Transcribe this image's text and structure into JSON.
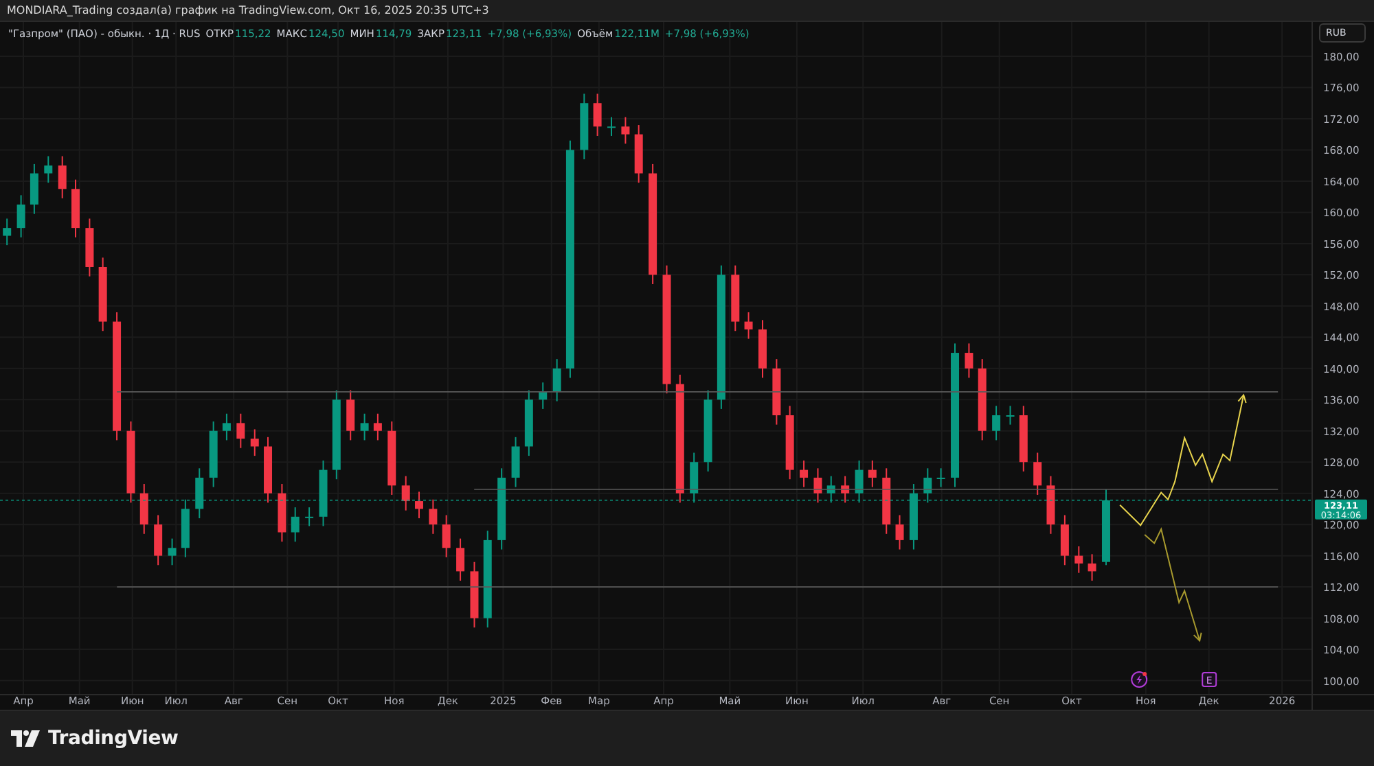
{
  "header": {
    "title": "MONDIARA_Trading создал(а) график на TradingView.com, Окт 16, 2025 20:35 UTC+3"
  },
  "legend": {
    "symbol": "\"Газпром\" (ПАО) - обыкн. · 1Д · RUS",
    "fields": [
      {
        "label": "ОТКР",
        "value": "115,22"
      },
      {
        "label": "МАКС",
        "value": "124,50"
      },
      {
        "label": "МИН",
        "value": "114,79"
      },
      {
        "label": "ЗАКР",
        "value": "123,11"
      },
      {
        "value": "+7,98 (+6,93%)"
      },
      {
        "label": "Объём",
        "value": "122,11M"
      },
      {
        "value": "+7,98 (+6,93%)"
      }
    ]
  },
  "currency_button": "RUB",
  "price_tag": {
    "countdown": "03:14:06"
  },
  "events": [
    {
      "kind": "dividend"
    },
    {
      "kind": "earnings",
      "label": "E"
    }
  ],
  "chart_data": {
    "type": "candlestick",
    "grid": true,
    "xlim": [
      2024.354,
      2026.118
    ],
    "ylim": [
      98.2,
      184.4
    ],
    "x": [
      2024.363,
      2024.381,
      2024.398,
      2024.416,
      2024.434,
      2024.451,
      2024.469,
      2024.486,
      2024.504,
      2024.522,
      2024.539,
      2024.557,
      2024.575,
      2024.592,
      2024.61,
      2024.628,
      2024.645,
      2024.663,
      2024.681,
      2024.698,
      2024.716,
      2024.733,
      2024.751,
      2024.769,
      2024.786,
      2024.804,
      2024.822,
      2024.839,
      2024.857,
      2024.875,
      2024.892,
      2024.91,
      2024.927,
      2024.945,
      2024.963,
      2024.98,
      2024.998,
      2025.016,
      2025.033,
      2025.051,
      2025.069,
      2025.086,
      2025.104,
      2025.121,
      2025.139,
      2025.157,
      2025.174,
      2025.192,
      2025.21,
      2025.227,
      2025.245,
      2025.263,
      2025.28,
      2025.298,
      2025.315,
      2025.333,
      2025.351,
      2025.368,
      2025.386,
      2025.404,
      2025.421,
      2025.439,
      2025.457,
      2025.474,
      2025.492,
      2025.509,
      2025.527,
      2025.545,
      2025.562,
      2025.58,
      2025.598,
      2025.615,
      2025.633,
      2025.651,
      2025.668,
      2025.686,
      2025.703,
      2025.721,
      2025.739,
      2025.756,
      2025.774
    ],
    "ohlc": [
      [
        157,
        159.2,
        155.8,
        158
      ],
      [
        158,
        162.2,
        156.8,
        161
      ],
      [
        161,
        166.2,
        159.8,
        165
      ],
      [
        165,
        167.2,
        163.8,
        166
      ],
      [
        166,
        167.2,
        161.8,
        163
      ],
      [
        163,
        164.2,
        156.8,
        158
      ],
      [
        158,
        159.2,
        151.8,
        153
      ],
      [
        153,
        154.2,
        144.8,
        146
      ],
      [
        146,
        147.2,
        130.8,
        132
      ],
      [
        132,
        133.2,
        122.8,
        124
      ],
      [
        124,
        125.2,
        118.8,
        120
      ],
      [
        120,
        121.2,
        114.8,
        116
      ],
      [
        116,
        118.2,
        114.8,
        117
      ],
      [
        117,
        123.2,
        115.8,
        122
      ],
      [
        122,
        127.2,
        120.8,
        126
      ],
      [
        126,
        133.2,
        124.8,
        132
      ],
      [
        132,
        134.2,
        130.8,
        133
      ],
      [
        133,
        134.2,
        129.8,
        131
      ],
      [
        131,
        132.2,
        128.8,
        130
      ],
      [
        130,
        131.2,
        122.8,
        124
      ],
      [
        124,
        125.2,
        117.8,
        119
      ],
      [
        119,
        122.2,
        117.8,
        121
      ],
      [
        121,
        122.2,
        119.8,
        121
      ],
      [
        121,
        128.2,
        119.8,
        127
      ],
      [
        127,
        137.2,
        125.8,
        136
      ],
      [
        136,
        137.2,
        130.8,
        132
      ],
      [
        132,
        134.2,
        130.8,
        133
      ],
      [
        133,
        134.2,
        130.8,
        132
      ],
      [
        132,
        133.2,
        123.8,
        125
      ],
      [
        125,
        126.2,
        121.8,
        123
      ],
      [
        123,
        124.2,
        120.8,
        122
      ],
      [
        122,
        123.2,
        118.8,
        120
      ],
      [
        120,
        121.2,
        115.8,
        117
      ],
      [
        117,
        118.2,
        112.8,
        114
      ],
      [
        114,
        115.2,
        106.8,
        108
      ],
      [
        108,
        119.2,
        106.8,
        118
      ],
      [
        118,
        127.2,
        116.8,
        126
      ],
      [
        126,
        131.2,
        124.8,
        130
      ],
      [
        130,
        137.2,
        128.8,
        136
      ],
      [
        136,
        138.2,
        134.8,
        137
      ],
      [
        137,
        141.2,
        135.8,
        140
      ],
      [
        140,
        169.2,
        138.8,
        168
      ],
      [
        168,
        175.2,
        166.8,
        174
      ],
      [
        174,
        175.2,
        169.8,
        171
      ],
      [
        171,
        172.2,
        169.8,
        171
      ],
      [
        171,
        172.2,
        168.8,
        170
      ],
      [
        170,
        171.2,
        163.8,
        165
      ],
      [
        165,
        166.2,
        150.8,
        152
      ],
      [
        152,
        153.2,
        136.8,
        138
      ],
      [
        138,
        139.2,
        122.8,
        124
      ],
      [
        124,
        129.2,
        122.8,
        128
      ],
      [
        128,
        137.2,
        126.8,
        136
      ],
      [
        136,
        153.2,
        134.8,
        152
      ],
      [
        152,
        153.2,
        144.8,
        146
      ],
      [
        146,
        147.2,
        143.8,
        145
      ],
      [
        145,
        146.2,
        138.8,
        140
      ],
      [
        140,
        141.2,
        132.8,
        134
      ],
      [
        134,
        135.2,
        125.8,
        127
      ],
      [
        127,
        128.2,
        124.8,
        126
      ],
      [
        126,
        127.2,
        122.8,
        124
      ],
      [
        124,
        126.2,
        122.8,
        125
      ],
      [
        125,
        126.2,
        122.8,
        124
      ],
      [
        124,
        128.2,
        122.8,
        127
      ],
      [
        127,
        128.2,
        124.8,
        126
      ],
      [
        126,
        127.2,
        118.8,
        120
      ],
      [
        120,
        121.2,
        116.8,
        118
      ],
      [
        118,
        125.2,
        116.8,
        124
      ],
      [
        124,
        127.2,
        122.8,
        126
      ],
      [
        126,
        127.2,
        124.8,
        126
      ],
      [
        126,
        143.2,
        124.8,
        142
      ],
      [
        142,
        143.2,
        138.8,
        140
      ],
      [
        140,
        141.2,
        130.8,
        132
      ],
      [
        132,
        135.2,
        130.8,
        134
      ],
      [
        134,
        135.2,
        132.8,
        134
      ],
      [
        134,
        135.2,
        126.8,
        128
      ],
      [
        128,
        129.2,
        123.8,
        125
      ],
      [
        125,
        126.2,
        118.8,
        120
      ],
      [
        120,
        121.2,
        114.8,
        116
      ],
      [
        116,
        117.2,
        113.8,
        115
      ],
      [
        115,
        116.2,
        112.8,
        114
      ],
      [
        115.2,
        124.5,
        114.8,
        123.1
      ]
    ],
    "xticks": [
      {
        "value": 2024.384,
        "label": "Апр"
      },
      {
        "value": 2024.456,
        "label": "Май"
      },
      {
        "value": 2024.524,
        "label": "Июн"
      },
      {
        "value": 2024.58,
        "label": "Июл"
      },
      {
        "value": 2024.654,
        "label": "Авг"
      },
      {
        "value": 2024.723,
        "label": "Сен"
      },
      {
        "value": 2024.788,
        "label": "Окт"
      },
      {
        "value": 2024.86,
        "label": "Ноя"
      },
      {
        "value": 2024.929,
        "label": "Дек"
      },
      {
        "value": 2025,
        "label": "2025"
      },
      {
        "value": 2025.062,
        "label": "Фев"
      },
      {
        "value": 2025.123,
        "label": "Мар"
      },
      {
        "value": 2025.206,
        "label": "Апр"
      },
      {
        "value": 2025.291,
        "label": "Май"
      },
      {
        "value": 2025.377,
        "label": "Июн"
      },
      {
        "value": 2025.462,
        "label": "Июл"
      },
      {
        "value": 2025.563,
        "label": "Авг"
      },
      {
        "value": 2025.637,
        "label": "Сен"
      },
      {
        "value": 2025.73,
        "label": "Окт"
      },
      {
        "value": 2025.825,
        "label": "Ноя"
      },
      {
        "value": 2025.906,
        "label": "Дек"
      },
      {
        "value": 2026,
        "label": "2026"
      }
    ],
    "yticks": [
      {
        "value": 100,
        "label": "100,00"
      },
      {
        "value": 104,
        "label": "104,00"
      },
      {
        "value": 108,
        "label": "108,00"
      },
      {
        "value": 112,
        "label": "112,00"
      },
      {
        "value": 116,
        "label": "116,00"
      },
      {
        "value": 120,
        "label": "120,00"
      },
      {
        "value": 124,
        "label": "124,00"
      },
      {
        "value": 128,
        "label": "128,00"
      },
      {
        "value": 132,
        "label": "132,00"
      },
      {
        "value": 136,
        "label": "136,00"
      },
      {
        "value": 140,
        "label": "140,00"
      },
      {
        "value": 144,
        "label": "144,00"
      },
      {
        "value": 148,
        "label": "148,00"
      },
      {
        "value": 152,
        "label": "152,00"
      },
      {
        "value": 156,
        "label": "156,00"
      },
      {
        "value": 160,
        "label": "160,00"
      },
      {
        "value": 164,
        "label": "164,00"
      },
      {
        "value": 168,
        "label": "168,00"
      },
      {
        "value": 172,
        "label": "172,00"
      },
      {
        "value": 176,
        "label": "176,00"
      },
      {
        "value": 180,
        "label": "180,00"
      }
    ],
    "ref_lines": [
      {
        "axis": "y",
        "value": 137
      },
      {
        "axis": "y",
        "value": 124.5
      },
      {
        "axis": "y",
        "value": 112
      },
      {
        "axis": "y",
        "value": 123.11,
        "label": "123,11",
        "line_style": "dashed"
      }
    ]
  },
  "footer": {
    "brand": "TradingView"
  }
}
